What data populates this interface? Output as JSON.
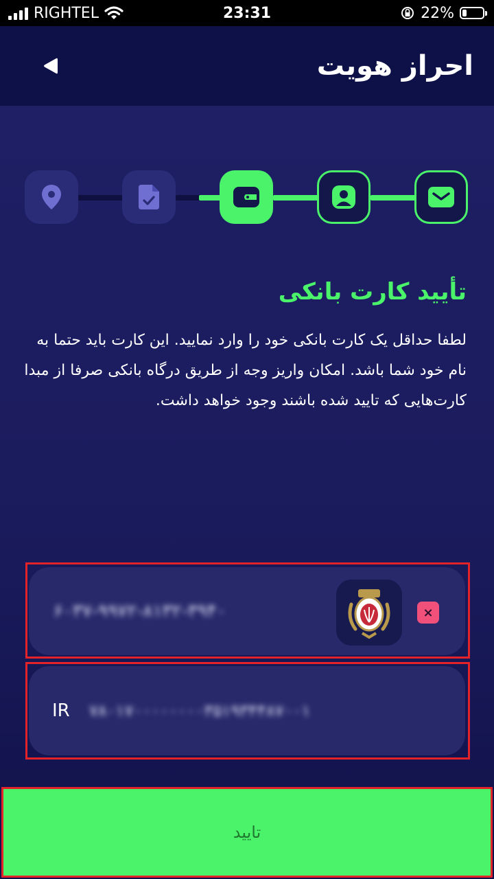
{
  "status_bar": {
    "carrier": "RIGHTEL",
    "time": "23:31",
    "battery_percent": "22%",
    "battery_level": 0.22,
    "icons": [
      "signal-icon",
      "wifi-icon",
      "rotation-lock-icon",
      "battery-icon"
    ]
  },
  "header": {
    "title": "احراز هویت",
    "back_icon": "back-arrow-icon"
  },
  "stepper": {
    "steps": [
      {
        "icon": "email-icon",
        "state": "done"
      },
      {
        "icon": "user-card-icon",
        "state": "done"
      },
      {
        "icon": "wallet-icon",
        "state": "current"
      },
      {
        "icon": "document-check-icon",
        "state": "pending"
      },
      {
        "icon": "location-pin-icon",
        "state": "pending"
      }
    ]
  },
  "section": {
    "title": "تأیید کارت بانکی",
    "description": "لطفا حداقل یک کارت بانکی خود را وارد نمایید. این کارت باید حتما به نام خود شما باشد. امکان واریز وجه از طریق درگاه بانکی صرفا از مبدا کارت‌هایی که تایید شده باشند وجود خواهد داشت."
  },
  "bank_card": {
    "card_number": "۶۰۳۷-۹۹۷۲-۸۱۳۲-۳۹۴۰",
    "bank_logo_icon": "bank-melli-logo-icon",
    "remove_label": "×"
  },
  "iban": {
    "prefix": "IR",
    "value": "۷۸۰۱۷۰۰۰۰۰۰۰۰۳۵۱۹۳۴۴۸۷۰۰۱"
  },
  "confirm_button": {
    "label": "تایید"
  },
  "colors": {
    "accent": "#4af36a",
    "background": "#1b1c5e",
    "header": "#0e1048",
    "card": "#27296b",
    "pending_step": "#2a2c78",
    "highlight_outline": "#e2232a",
    "remove": "#f0507a"
  }
}
